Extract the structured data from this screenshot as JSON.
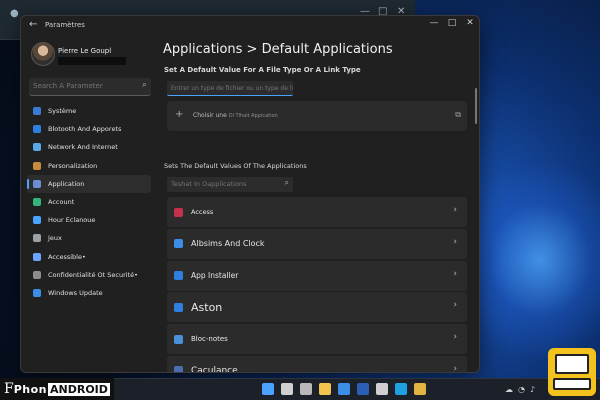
{
  "window": {
    "title": "Paramètres",
    "controls": {
      "minimize": "—",
      "maximize": "□",
      "close": "✕"
    }
  },
  "user": {
    "name": "Pierre Le Goupl"
  },
  "search": {
    "placeholder": "Search A Parameter"
  },
  "nav": [
    {
      "label": "Système",
      "icon": "system-icon",
      "color": "#3a7bd5",
      "active": false
    },
    {
      "label": "Blotooth And Apporets",
      "icon": "bluetooth-icon",
      "color": "#2f7fe0",
      "active": false
    },
    {
      "label": "Network And Internet",
      "icon": "network-icon",
      "color": "#5aa9e6",
      "active": false
    },
    {
      "label": "Personalization",
      "icon": "brush-icon",
      "color": "#c98a3d",
      "active": false
    },
    {
      "label": "Application",
      "icon": "apps-icon",
      "color": "#6c8ed6",
      "active": true
    },
    {
      "label": "Account",
      "icon": "account-icon",
      "color": "#34b37a",
      "active": false
    },
    {
      "label": "Hour Eclanoue",
      "icon": "clock-language-icon",
      "color": "#4aa3ff",
      "active": false
    },
    {
      "label": "Jeux",
      "icon": "game-icon",
      "color": "#9aa0a6",
      "active": false
    },
    {
      "label": "Accessible•",
      "icon": "accessibility-icon",
      "color": "#6aa7ff",
      "active": false
    },
    {
      "label": "Confidentialité Ot Securité•",
      "icon": "shield-icon",
      "color": "#8c8c8c",
      "active": false
    },
    {
      "label": "Windows Update",
      "icon": "update-icon",
      "color": "#3a8ee6",
      "active": false
    }
  ],
  "main": {
    "breadcrumb": "Applications > Default Applications",
    "section1_title": "Set A Default Value For A File Type Or A Link Type",
    "filetype_placeholder": "Entrer un type de fichier ou un type de lien",
    "choose_label": "Choisir une",
    "choose_label_overlay": "Dl Tlhait Appication",
    "section2_title": "Sets The Default Values Of The Applications",
    "apps_search_placeholder": "Teshat In Oapplications",
    "apps": [
      {
        "name": "Access",
        "icon": "access-icon",
        "color": "#c4314b",
        "size": 6.5
      },
      {
        "name": "Albsims And Clock",
        "icon": "alarm-clock-icon",
        "color": "#3a8ee6",
        "size": 8
      },
      {
        "name": "App Installer",
        "icon": "app-installer-icon",
        "color": "#2f7fe0",
        "size": 7.5
      },
      {
        "name": "Aston",
        "icon": "aston-icon",
        "color": "#2f7fe0",
        "size": 11
      },
      {
        "name": "Bloc-notes",
        "icon": "notepad-icon",
        "color": "#4a90d9",
        "size": 7
      },
      {
        "name": "Caculance",
        "icon": "calculator-icon",
        "color": "#4a6fb0",
        "size": 9
      }
    ]
  },
  "taskbar": {
    "icons": [
      {
        "name": "start-icon",
        "color": "#4aa3ff"
      },
      {
        "name": "search-icon",
        "color": "#d0d0d0"
      },
      {
        "name": "settings-icon",
        "color": "#b8b8b8"
      },
      {
        "name": "file-explorer-icon",
        "color": "#f2c34e"
      },
      {
        "name": "store-icon",
        "color": "#3a8ee6"
      },
      {
        "name": "word-icon",
        "color": "#2b5fb5"
      },
      {
        "name": "mail-icon",
        "color": "#cfcfcf"
      },
      {
        "name": "skype-icon",
        "color": "#1fa1e0"
      },
      {
        "name": "chrome-icon",
        "color": "#e3b341"
      }
    ]
  },
  "watermark": {
    "part1": "F",
    "part2": "Phon",
    "part3": "ANDROID"
  }
}
